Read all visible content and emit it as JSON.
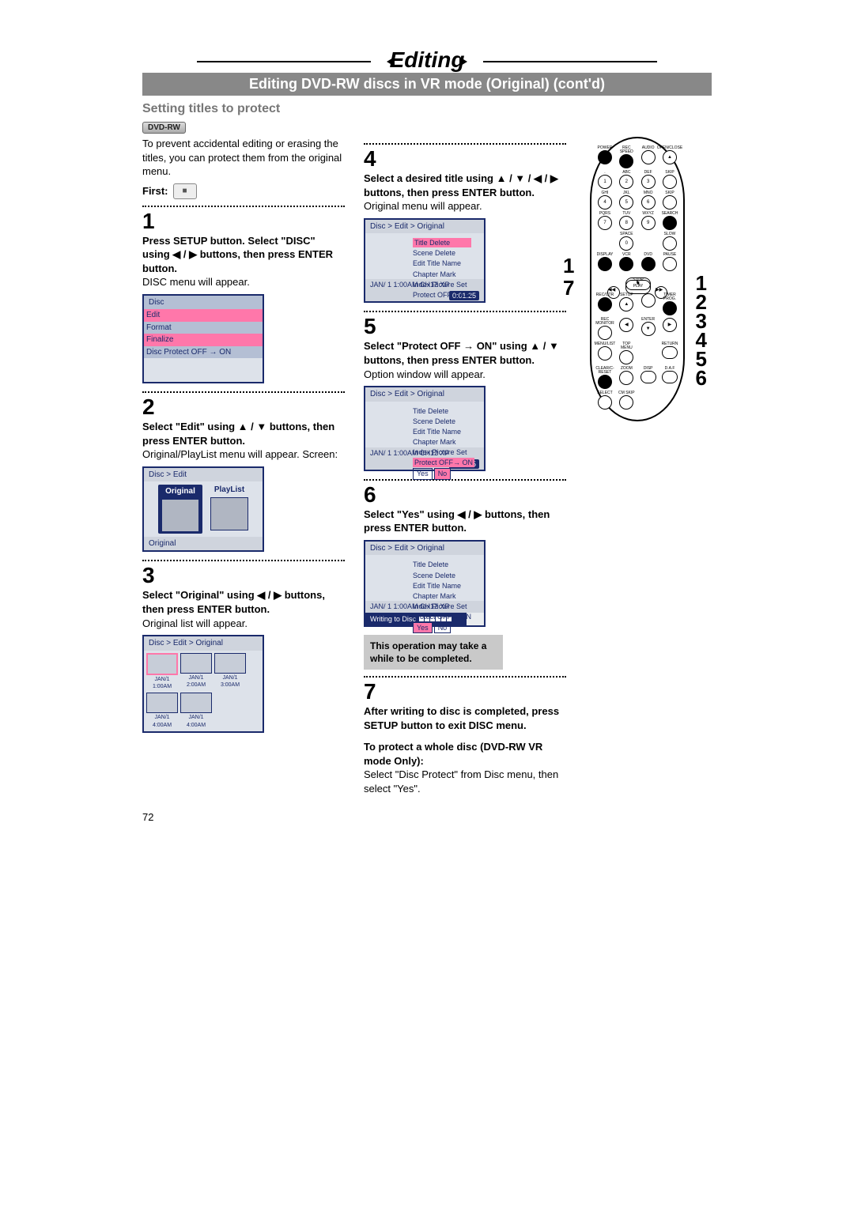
{
  "page_number": "72",
  "header": {
    "title": "Editing",
    "subtitle": "Editing DVD-RW discs in VR mode (Original) (cont'd)"
  },
  "section_title": "Setting titles to protect",
  "badge": "DVD-RW",
  "col1": {
    "intro": "To prevent accidental editing or erasing the titles, you can protect them from the original menu.",
    "first_label": "First:",
    "step1_num": "1",
    "step1_bold": "Press SETUP button. Select \"DISC\" using ◀ / ▶ buttons, then press ENTER button.",
    "step1_body": "DISC menu will appear.",
    "screen1": {
      "title": "Disc",
      "items": [
        "Edit",
        "Format",
        "Finalize",
        "Disc Protect OFF → ON"
      ]
    },
    "step2_num": "2",
    "step2_bold": "Select \"Edit\" using ▲ / ▼ buttons, then press ENTER button.",
    "step2_body": "Original/PlayList menu will appear. Screen:",
    "screen2": {
      "title": "Disc > Edit",
      "opt1": "Original",
      "opt2": "PlayList",
      "footer": "Original"
    },
    "step3_num": "3",
    "step3_bold": "Select \"Original\" using ◀ / ▶ buttons, then press ENTER button.",
    "step3_body": "Original list will appear.",
    "screen3": {
      "title": "Disc > Edit > Original",
      "thumbs": [
        "JAN/1  1:00AM",
        "JAN/1  2:00AM",
        "JAN/1  3:00AM",
        "JAN/1  4:00AM",
        "JAN/1  4:00AM"
      ]
    }
  },
  "col2": {
    "step4_num": "4",
    "step4_bold": "Select a desired title using ▲ / ▼ / ◀ / ▶ buttons, then press ENTER button.",
    "step4_body": "Original menu will appear.",
    "screen4": {
      "title": "Disc > Edit > Original",
      "menu": [
        "Title Delete",
        "Scene Delete",
        "Edit Title Name",
        "Chapter Mark",
        "Index Picture Set",
        "Protect OFF→ ON"
      ],
      "highlight": "Title Delete",
      "foot_l": "JAN/ 1   1:00AM  CH12    XP",
      "foot_r": "0:01:25"
    },
    "step5_num": "5",
    "step5_bold": "Select \"Protect OFF → ON\" using ▲ / ▼ buttons, then press ENTER button.",
    "step5_body": "Option window will appear.",
    "screen5": {
      "title": "Disc > Edit > Original",
      "menu": [
        "Title Delete",
        "Scene Delete",
        "Edit Title Name",
        "Chapter Mark",
        "Index Picture Set",
        "Protect OFF→ ON"
      ],
      "yes": "Yes",
      "no": "No",
      "foot_l": "JAN/ 1   1:00AM  CH12    XP",
      "foot_r": "0:01:25"
    },
    "step6_num": "6",
    "step6_bold": "Select \"Yes\" using ◀ / ▶ buttons, then press ENTER button.",
    "screen6": {
      "title": "Disc > Edit > Original",
      "menu": [
        "Title Delete",
        "Scene Delete",
        "Edit Title Name",
        "Chapter Mark",
        "Index Picture Set",
        "Protect OFF→ ON"
      ],
      "yes": "Yes",
      "no": "No",
      "foot_l": "JAN/ 1   1:00AM  CH12    XP",
      "write": "Writing to Disc"
    },
    "note": "This operation may take a while to be completed.",
    "step7_num": "7",
    "step7_bold": "After writing to disc is completed, press SETUP button to exit DISC menu.",
    "extra_bold": "To protect a whole disc (DVD-RW VR mode Only):",
    "extra_body": "Select \"Disc Protect\" from Disc menu, then select \"Yes\"."
  },
  "remote": {
    "row1": [
      "POWER",
      "REC SPEED",
      "AUDIO",
      "OPEN/CLOSE"
    ],
    "row1b": [
      "",
      "●",
      "",
      ""
    ],
    "numrow1": [
      ".",
      "ABC",
      "DEF",
      "SKIP"
    ],
    "num1": [
      "1",
      "2",
      "3",
      ""
    ],
    "numrow2": [
      "GHI",
      "JKL",
      "MNO",
      "SKIP"
    ],
    "num2": [
      "4",
      "5",
      "6",
      ""
    ],
    "numrow3": [
      "PQRS",
      "TUV",
      "WXYZ",
      "SEARCH"
    ],
    "num3": [
      "7",
      "8",
      "9",
      ""
    ],
    "row_space": [
      "",
      "SPACE",
      "",
      "SLOW"
    ],
    "num4": [
      "",
      "0",
      "",
      ""
    ],
    "row_disp": [
      "DISPLAY",
      "VCR",
      "DVD",
      "PAUSE"
    ],
    "play": "PLAY",
    "stop": "STOP",
    "row_rec": [
      "REC/OTR",
      "SETUP",
      "",
      "TIMER PROG."
    ],
    "row_mon": [
      "REC MONITOR",
      "",
      "ENTER",
      ""
    ],
    "row_menu": [
      "MENU/LIST",
      "TOP MENU",
      "",
      "RETURN"
    ],
    "row_clr": [
      "CLEAR/C-RESET",
      "ZOOM",
      "DISP",
      "D.A.F"
    ],
    "row_final": [
      "SELECT",
      "CM SKIP",
      "",
      ""
    ]
  },
  "callouts": {
    "left_top": "1",
    "left_bot": "7",
    "right": [
      "1",
      "2",
      "3",
      "4",
      "5",
      "6"
    ]
  }
}
